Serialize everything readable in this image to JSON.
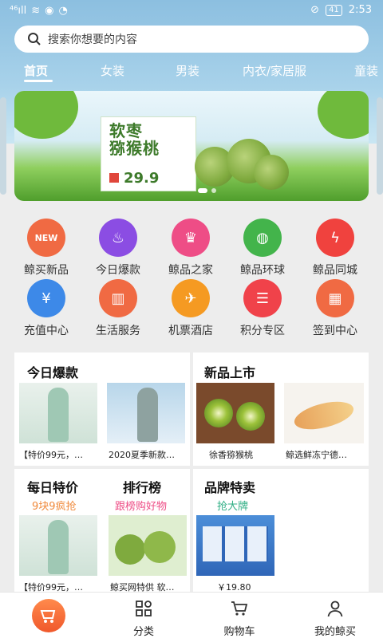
{
  "status_bar": {
    "left": "⁴⁶ıll",
    "battery": "41",
    "time": "2:53"
  },
  "search": {
    "placeholder": "搜索你想要的内容"
  },
  "tabs": [
    "首页",
    "女装",
    "男装",
    "内衣/家居服",
    "童装"
  ],
  "banner": {
    "title_line1": "软枣",
    "title_line2": "猕猴桃",
    "price": "29.9"
  },
  "shortcuts": [
    {
      "label": "鲸买新品",
      "icon": "new-icon",
      "color": "#f06a43"
    },
    {
      "label": "今日爆款",
      "icon": "flame-icon",
      "color": "#8b4de3"
    },
    {
      "label": "鲸品之家",
      "icon": "crown-icon",
      "color": "#ee4d86"
    },
    {
      "label": "鲸品环球",
      "icon": "globe-icon",
      "color": "#43b44b"
    },
    {
      "label": "鲸品同城",
      "icon": "lightning-icon",
      "color": "#f0423e"
    },
    {
      "label": "充值中心",
      "icon": "yen-icon",
      "color": "#3d89e8"
    },
    {
      "label": "生活服务",
      "icon": "building-icon",
      "color": "#f06a43"
    },
    {
      "label": "机票酒店",
      "icon": "plane-icon",
      "color": "#f59a22"
    },
    {
      "label": "积分专区",
      "icon": "database-icon",
      "color": "#f0424a"
    },
    {
      "label": "签到中心",
      "icon": "calendar-icon",
      "color": "#f06a43"
    }
  ],
  "today_hot": {
    "title": "今日爆款",
    "items": [
      "【特价99元，…",
      "2020夏季新款…"
    ]
  },
  "new_arrivals": {
    "title": "新品上市",
    "items": [
      "徐香猕猴桃",
      "鲸选鲜冻宁德…"
    ]
  },
  "daily_deal": {
    "title": "每日特价",
    "subtitle": "9块9疯抢",
    "item": "【特价99元，…"
  },
  "ranking": {
    "title": "排行榜",
    "subtitle": "跟榜购好物",
    "item": "鲸买网特供 软…"
  },
  "brand_sale": {
    "title": "品牌特卖",
    "subtitle": "抢大牌",
    "item": "￥19.80"
  },
  "bottom_nav": [
    "分类",
    "购物车",
    "我的鲸买"
  ],
  "colors": {
    "accent": "#f06a43",
    "header": "#8cbfe0",
    "sale_orange": "#f08a3c",
    "sale_pink": "#ee4d86",
    "sale_green": "#2fae84"
  }
}
